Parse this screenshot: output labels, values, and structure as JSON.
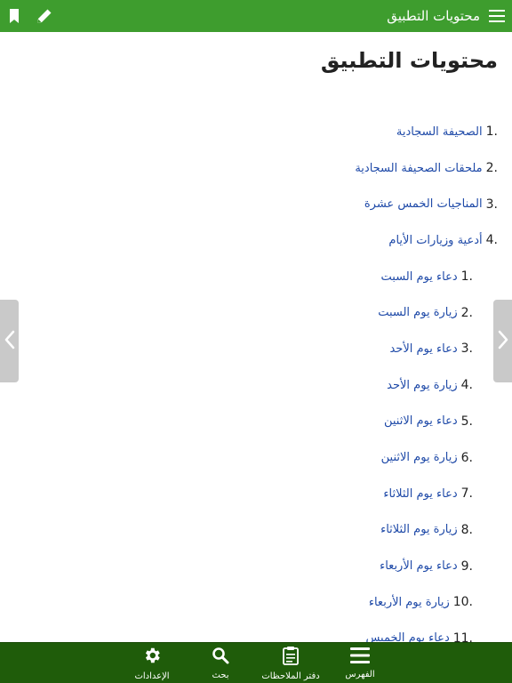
{
  "topbar": {
    "title": "محتويات التطبيق",
    "icons": [
      "menu-icon",
      "pencil-icon",
      "bookmark-icon"
    ]
  },
  "page": {
    "title": "محتويات التطبيق"
  },
  "toc": [
    {
      "num": "1.",
      "label": "الصحيفة السجادية"
    },
    {
      "num": "2.",
      "label": "ملحقات الصحيفة السجادية"
    },
    {
      "num": "3.",
      "label": "المناجيات الخمس عشرة"
    },
    {
      "num": "4.",
      "label": "أدعية وزيارات الأيام"
    }
  ],
  "toc_sub": [
    {
      "num": "1.",
      "label": "دعاء يوم السبت"
    },
    {
      "num": "2.",
      "label": "زيارة يوم السبت"
    },
    {
      "num": "3.",
      "label": "دعاء يوم الأحد"
    },
    {
      "num": "4.",
      "label": "زيارة يوم الأحد"
    },
    {
      "num": "5.",
      "label": "دعاء يوم الاثنين"
    },
    {
      "num": "6.",
      "label": "زيارة يوم الاثنين"
    },
    {
      "num": "7.",
      "label": "دعاء يوم الثلاثاء"
    },
    {
      "num": "8.",
      "label": "زيارة يوم الثلاثاء"
    },
    {
      "num": "9.",
      "label": "دعاء يوم الأربعاء"
    },
    {
      "num": "10.",
      "label": "زيارة يوم الأربعاء"
    },
    {
      "num": "11.",
      "label": "دعاء يوم الخميس"
    }
  ],
  "bottom_nav": {
    "index": {
      "label": "الفهرس",
      "icon": "list-icon"
    },
    "notes": {
      "label": "دفتر الملاحظات",
      "icon": "clipboard-icon"
    },
    "search": {
      "label": "بحث",
      "icon": "search-icon"
    },
    "settings": {
      "label": "الإعدادات",
      "icon": "gear-icon"
    }
  },
  "side_arrows": {
    "left": "chevron-left-icon",
    "right": "chevron-right-icon"
  },
  "colors": {
    "topbar": "#3e9d2e",
    "bottombar": "#1f5c0a",
    "link": "#1f4aa8",
    "side_tab": "#c9c9c9"
  }
}
